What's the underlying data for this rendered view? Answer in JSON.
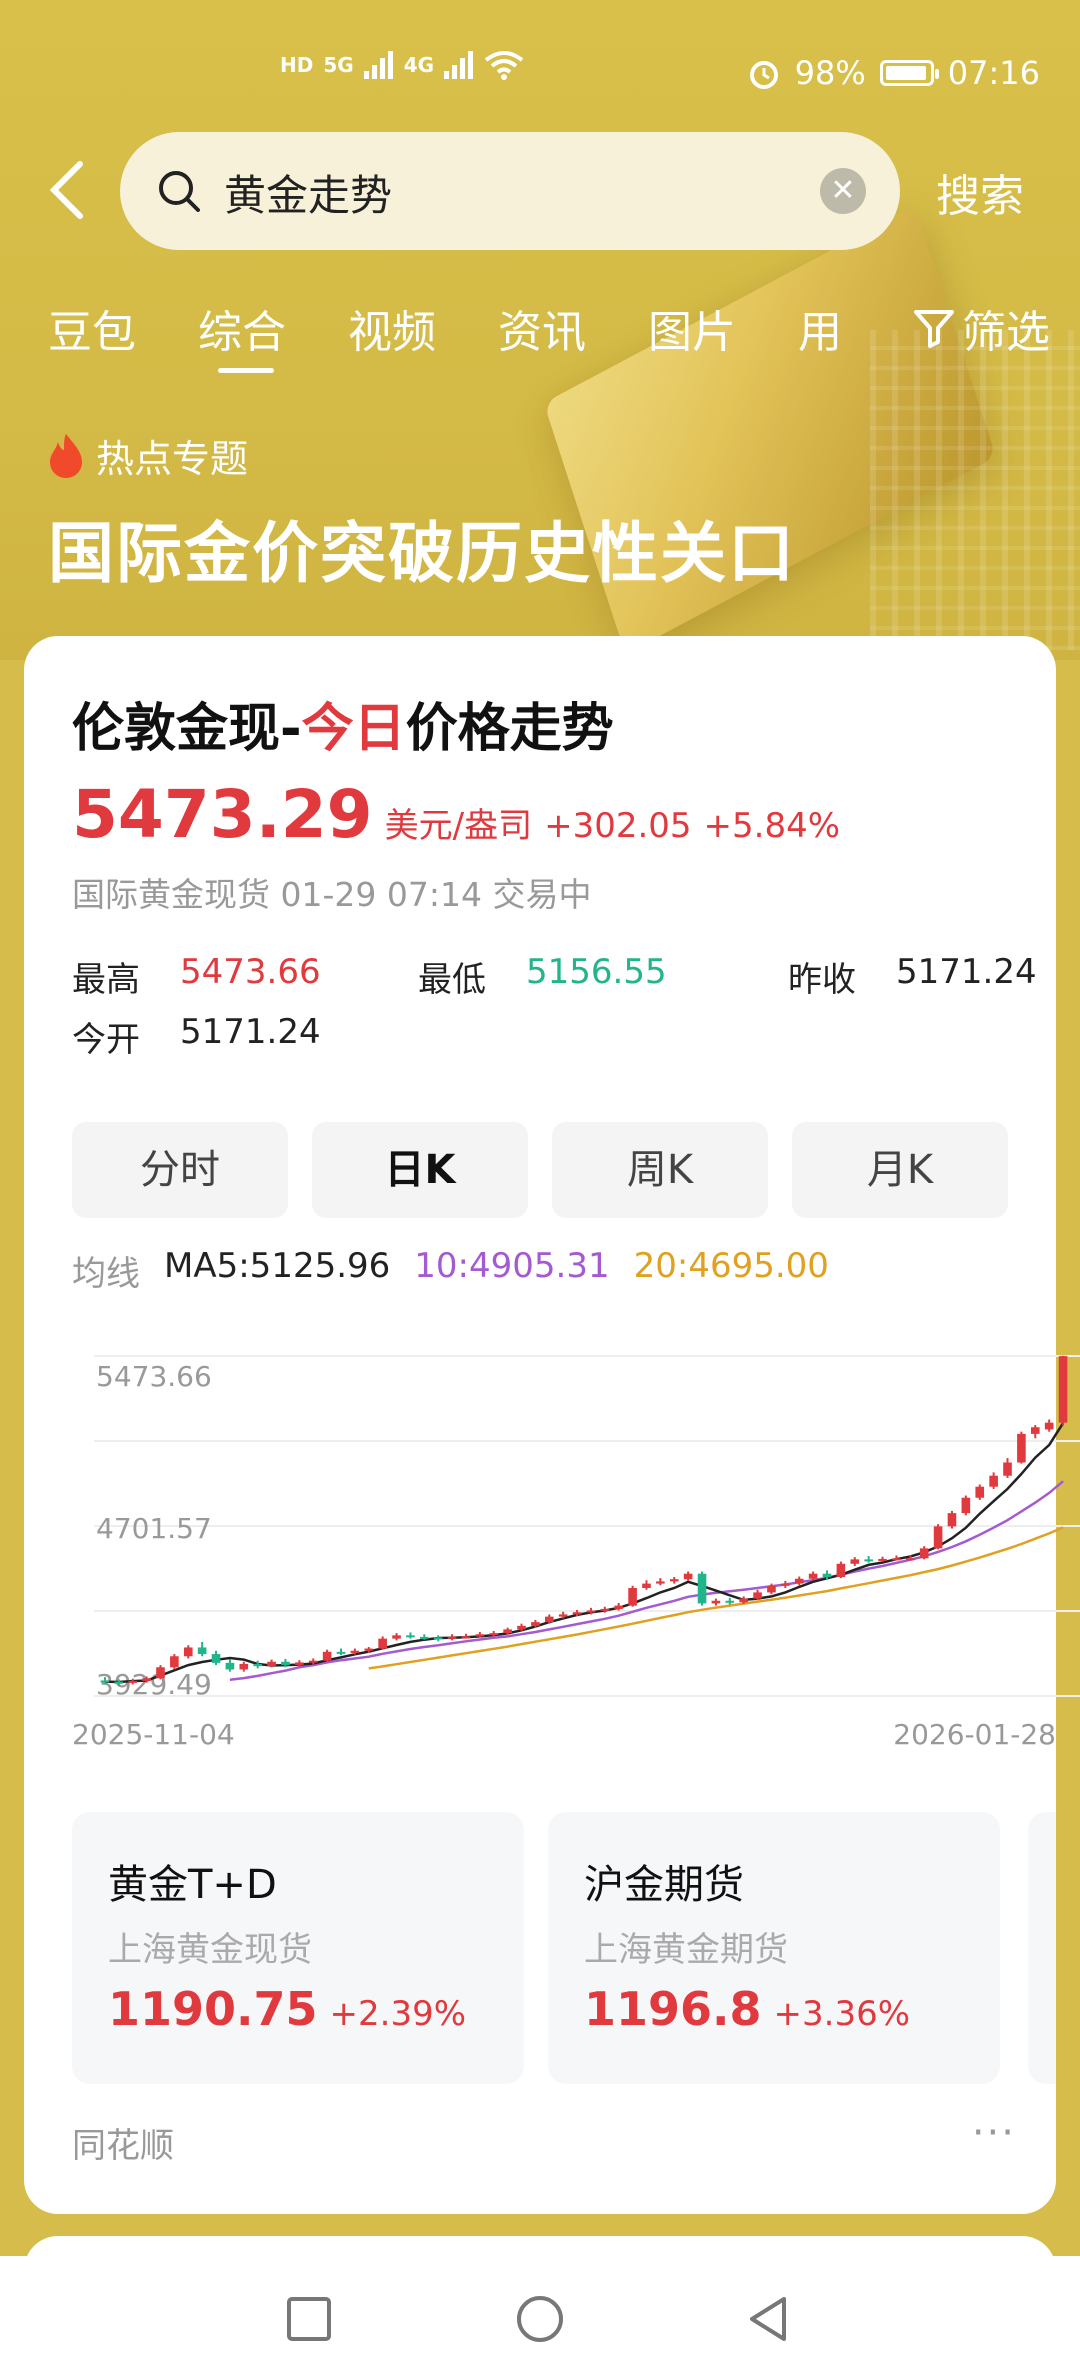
{
  "status_bar": {
    "hd1": "HD",
    "hd2": "HD",
    "net1": "5G",
    "net2": "4G",
    "battery": "98%",
    "time": "07:16"
  },
  "search": {
    "query": "黄金走势",
    "button": "搜索"
  },
  "tabs": [
    "豆包",
    "综合",
    "视频",
    "资讯",
    "图片",
    "用"
  ],
  "active_tab": "综合",
  "filter_label": "筛选",
  "hero": {
    "tag": "热点专题",
    "title": "国际金价突破历史性关口"
  },
  "card": {
    "title_prefix": "伦敦金现-",
    "title_highlight": "今日",
    "title_suffix": "价格走势",
    "price": "5473.29",
    "unit": "美元/盎司",
    "change": "+302.05",
    "change_pct": "+5.84%",
    "sub_info": "国际黄金现货 01-29 07:14 交易中",
    "stats": {
      "high_label": "最高",
      "high": "5473.66",
      "low_label": "最低",
      "low": "5156.55",
      "prev_label": "昨收",
      "prev": "5171.24",
      "open_label": "今开",
      "open": "5171.24"
    },
    "ktabs": [
      "分时",
      "日K",
      "周K",
      "月K"
    ],
    "active_ktab": "日K",
    "ma": {
      "label": "均线",
      "ma5": "MA5:5125.96",
      "ma10": "10:4905.31",
      "ma20": "20:4695.00"
    },
    "source": "同花顺",
    "more": "···"
  },
  "colors": {
    "up": "#e0393e",
    "down": "#21b58c",
    "ma5": "#222222",
    "ma10": "#a45ad0",
    "ma20": "#e0a020"
  },
  "chart_data": {
    "type": "candlestick",
    "y_tick_labels": [
      "5473.66",
      "4701.57",
      "3929.49"
    ],
    "ylim": [
      3929.49,
      5473.66
    ],
    "x_start": "2025-11-04",
    "x_end": "2026-01-28",
    "candles": [
      [
        4000,
        3995,
        4015,
        3985
      ],
      [
        3995,
        3985,
        4005,
        3975
      ],
      [
        3990,
        3998,
        4008,
        3982
      ],
      [
        3998,
        4010,
        4018,
        3990
      ],
      [
        4010,
        4060,
        4070,
        4005
      ],
      [
        4060,
        4110,
        4120,
        4050
      ],
      [
        4110,
        4150,
        4160,
        4100
      ],
      [
        4150,
        4120,
        4175,
        4110
      ],
      [
        4120,
        4080,
        4135,
        4070
      ],
      [
        4080,
        4050,
        4095,
        4040
      ],
      [
        4050,
        4075,
        4085,
        4040
      ],
      [
        4075,
        4065,
        4090,
        4055
      ],
      [
        4065,
        4085,
        4095,
        4060
      ],
      [
        4085,
        4070,
        4098,
        4060
      ],
      [
        4070,
        4082,
        4092,
        4062
      ],
      [
        4082,
        4090,
        4100,
        4072
      ],
      [
        4090,
        4130,
        4140,
        4085
      ],
      [
        4130,
        4125,
        4145,
        4115
      ],
      [
        4125,
        4135,
        4145,
        4118
      ],
      [
        4135,
        4145,
        4152,
        4125
      ],
      [
        4145,
        4190,
        4200,
        4140
      ],
      [
        4190,
        4205,
        4215,
        4182
      ],
      [
        4205,
        4198,
        4218,
        4190
      ],
      [
        4198,
        4196,
        4210,
        4185
      ],
      [
        4196,
        4190,
        4205,
        4178
      ],
      [
        4190,
        4198,
        4210,
        4182
      ],
      [
        4198,
        4200,
        4212,
        4190
      ],
      [
        4200,
        4210,
        4220,
        4195
      ],
      [
        4210,
        4215,
        4225,
        4200
      ],
      [
        4215,
        4232,
        4240,
        4208
      ],
      [
        4232,
        4248,
        4258,
        4225
      ],
      [
        4248,
        4265,
        4275,
        4240
      ],
      [
        4265,
        4290,
        4300,
        4258
      ],
      [
        4290,
        4300,
        4312,
        4282
      ],
      [
        4300,
        4310,
        4320,
        4292
      ],
      [
        4310,
        4318,
        4330,
        4300
      ],
      [
        4318,
        4325,
        4335,
        4308
      ],
      [
        4325,
        4340,
        4352,
        4318
      ],
      [
        4340,
        4420,
        4430,
        4335
      ],
      [
        4420,
        4440,
        4455,
        4412
      ],
      [
        4440,
        4450,
        4465,
        4432
      ],
      [
        4450,
        4460,
        4470,
        4440
      ],
      [
        4460,
        4485,
        4495,
        4452
      ],
      [
        4485,
        4350,
        4495,
        4340
      ],
      [
        4350,
        4362,
        4372,
        4340
      ],
      [
        4362,
        4355,
        4375,
        4345
      ],
      [
        4355,
        4372,
        4382,
        4348
      ],
      [
        4372,
        4400,
        4412,
        4365
      ],
      [
        4400,
        4430,
        4440,
        4392
      ],
      [
        4430,
        4440,
        4452,
        4420
      ],
      [
        4440,
        4462,
        4472,
        4432
      ],
      [
        4462,
        4485,
        4495,
        4455
      ],
      [
        4485,
        4470,
        4500,
        4460
      ],
      [
        4470,
        4530,
        4540,
        4465
      ],
      [
        4530,
        4550,
        4560,
        4520
      ],
      [
        4550,
        4545,
        4565,
        4535
      ],
      [
        4545,
        4552,
        4562,
        4538
      ],
      [
        4552,
        4555,
        4568,
        4545
      ],
      [
        4555,
        4555,
        4570,
        4545
      ],
      [
        4555,
        4600,
        4610,
        4550
      ],
      [
        4600,
        4700,
        4710,
        4595
      ],
      [
        4700,
        4760,
        4770,
        4690
      ],
      [
        4760,
        4830,
        4840,
        4750
      ],
      [
        4830,
        4880,
        4890,
        4820
      ],
      [
        4880,
        4930,
        4945,
        4870
      ],
      [
        4930,
        4990,
        5010,
        4920
      ],
      [
        4990,
        5120,
        5130,
        4985
      ],
      [
        5120,
        5150,
        5160,
        5100
      ],
      [
        5140,
        5171,
        5185,
        5130
      ],
      [
        5171,
        5473,
        5474,
        5157
      ]
    ],
    "ma5": [
      3995,
      3993,
      3997,
      4000,
      4022,
      4046,
      4070,
      4084,
      4094,
      4102,
      4095,
      4075,
      4068,
      4070,
      4072,
      4077,
      4092,
      4105,
      4119,
      4131,
      4146,
      4161,
      4175,
      4185,
      4193,
      4194,
      4196,
      4200,
      4206,
      4214,
      4228,
      4245,
      4265,
      4282,
      4298,
      4309,
      4318,
      4330,
      4350,
      4374,
      4400,
      4420,
      4448,
      4429,
      4408,
      4387,
      4366,
      4372,
      4382,
      4400,
      4425,
      4448,
      4464,
      4480,
      4503,
      4525,
      4536,
      4551,
      4563,
      4582,
      4609,
      4646,
      4694,
      4757,
      4814,
      4870,
      4938,
      5012,
      5070,
      5169
    ],
    "ma10": [
      null,
      null,
      null,
      null,
      null,
      null,
      null,
      null,
      null,
      4003,
      4011,
      4021,
      4033,
      4045,
      4060,
      4070,
      4082,
      4092,
      4100,
      4108,
      4121,
      4132,
      4143,
      4152,
      4160,
      4169,
      4178,
      4186,
      4194,
      4200,
      4210,
      4220,
      4232,
      4244,
      4256,
      4268,
      4280,
      4294,
      4312,
      4330,
      4346,
      4362,
      4380,
      4390,
      4398,
      4405,
      4412,
      4420,
      4428,
      4436,
      4446,
      4456,
      4466,
      4480,
      4495,
      4508,
      4520,
      4534,
      4548,
      4564,
      4584,
      4606,
      4632,
      4662,
      4694,
      4728,
      4768,
      4808,
      4852,
      4905
    ],
    "ma20": [
      null,
      null,
      null,
      null,
      null,
      null,
      null,
      null,
      null,
      null,
      null,
      null,
      null,
      null,
      null,
      null,
      null,
      null,
      null,
      4055,
      4064,
      4074,
      4084,
      4094,
      4104,
      4114,
      4124,
      4134,
      4144,
      4154,
      4165,
      4176,
      4187,
      4198,
      4209,
      4221,
      4233,
      4245,
      4258,
      4271,
      4284,
      4297,
      4310,
      4321,
      4331,
      4340,
      4349,
      4358,
      4367,
      4376,
      4386,
      4396,
      4406,
      4418,
      4430,
      4442,
      4454,
      4466,
      4478,
      4492,
      4506,
      4522,
      4540,
      4558,
      4578,
      4598,
      4620,
      4644,
      4668,
      4695
    ]
  },
  "mini_cards": [
    {
      "title": "黄金T+D",
      "sub": "上海黄金现货",
      "price": "1190.75",
      "chg": "+2.39%"
    },
    {
      "title": "沪金期货",
      "sub": "上海黄金期货",
      "price": "1196.8",
      "chg": "+3.36%"
    }
  ]
}
